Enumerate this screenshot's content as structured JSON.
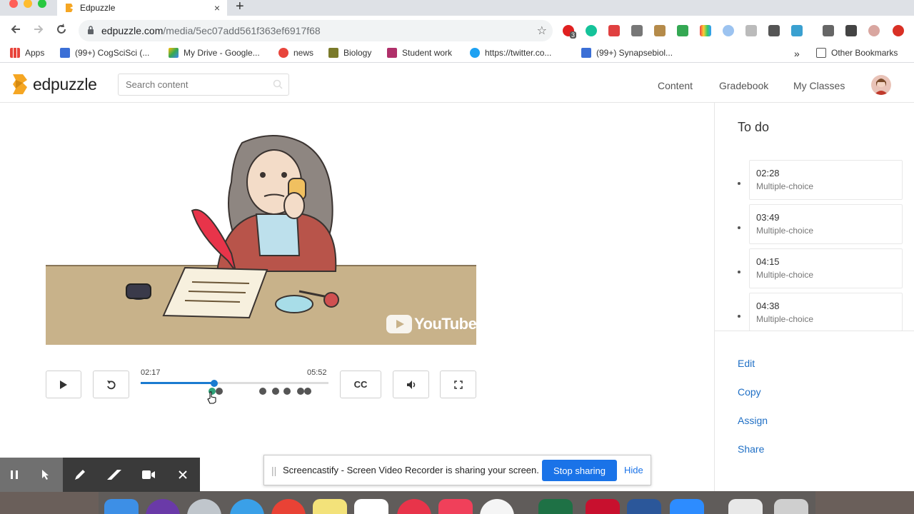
{
  "browser": {
    "tab_title": "Edpuzzle",
    "tab_close": "×",
    "new_tab": "+",
    "url_host": "edpuzzle.com",
    "url_path": "/media/5ec07add561f363ef6917f68",
    "ext_badge": "3"
  },
  "bookmarks": [
    {
      "label": "Apps"
    },
    {
      "label": "(99+) CogSciSci (..."
    },
    {
      "label": "My Drive - Google..."
    },
    {
      "label": "news"
    },
    {
      "label": "Biology"
    },
    {
      "label": "Student work"
    },
    {
      "label": "https://twitter.co..."
    },
    {
      "label": "(99+) Synapsebiol..."
    }
  ],
  "bookmarks_more": "»",
  "other_bookmarks": "Other Bookmarks",
  "header": {
    "logo": "edpuzzle",
    "search_placeholder": "Search content",
    "nav": [
      "Content",
      "Gradebook",
      "My Classes"
    ]
  },
  "video": {
    "watermark": "YouTube",
    "current_time": "02:17",
    "duration": "05:52",
    "progress": 0.39,
    "cc_label": "CC",
    "question_marks": [
      0.38,
      0.42,
      0.65,
      0.72,
      0.78,
      0.85,
      0.89
    ]
  },
  "panel": {
    "title": "To do",
    "questions": [
      {
        "time": "02:28",
        "type": "Multiple-choice"
      },
      {
        "time": "03:49",
        "type": "Multiple-choice"
      },
      {
        "time": "04:15",
        "type": "Multiple-choice"
      },
      {
        "time": "04:38",
        "type": "Multiple-choice"
      }
    ],
    "actions": [
      "Edit",
      "Copy",
      "Assign",
      "Share"
    ]
  },
  "screencastify": {
    "message": "Screencastify - Screen Video Recorder is sharing your screen.",
    "stop_label": "Stop sharing",
    "hide_label": "Hide"
  },
  "colors": {
    "accent": "#1a7bd0",
    "link": "#1f6fc5",
    "stop_button": "#1a73e8",
    "video_table": "#c8b28a"
  }
}
